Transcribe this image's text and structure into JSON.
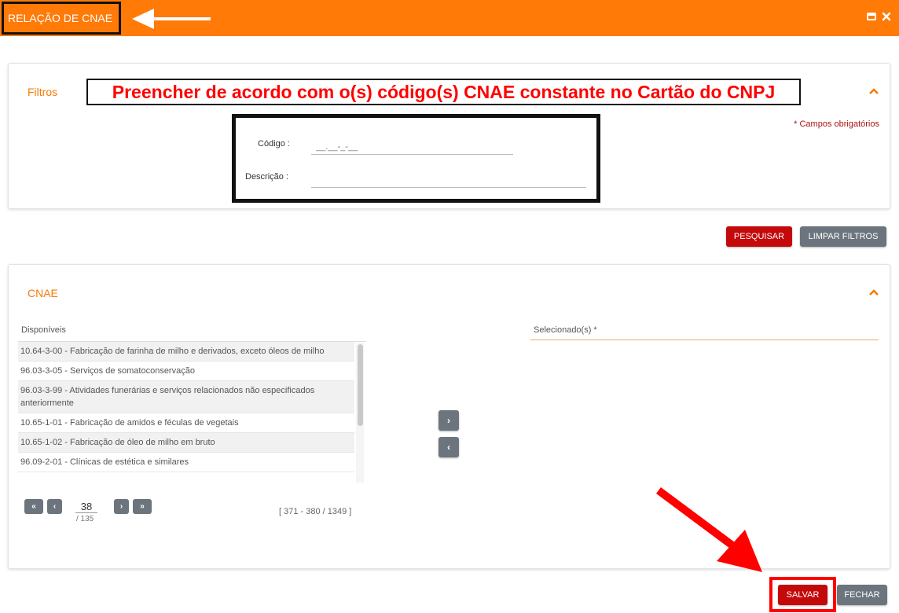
{
  "window": {
    "title": "RELAÇÃO DE CNAE",
    "icons": [
      "window-icon",
      "close-icon"
    ]
  },
  "annotation": {
    "banner": "Preencher de acordo com o(s) código(s) CNAE constante no Cartão do CNPJ"
  },
  "filters": {
    "title": "Filtros",
    "required_note": "* Campos obrigatórios",
    "codigo_label": "Código :",
    "codigo_placeholder": "__.__-_-__",
    "descricao_label": "Descrição :",
    "descricao_value": ""
  },
  "filter_buttons": {
    "search": "PESQUISAR",
    "clear": "LIMPAR FILTROS"
  },
  "cnae": {
    "title": "CNAE",
    "available_header": "Disponíveis",
    "selected_header": "Selecionado(s) *",
    "available_items": [
      "10.64-3-00 - Fabricação de farinha de milho e derivados, exceto óleos de milho",
      "96.03-3-05 - Serviços de somatoconservação",
      "96.03-3-99 - Atividades funerárias e serviços relacionados não especificados anteriormente",
      "10.65-1-01 - Fabricação de amidos e féculas de vegetais",
      "10.65-1-02 - Fabricação de óleo de milho em bruto",
      "96.09-2-01 - Clínicas de estética e similares"
    ],
    "move_right": "›",
    "move_left": "‹"
  },
  "pagination": {
    "first": "«",
    "prev": "‹",
    "next": "›",
    "last": "»",
    "current_page": "38",
    "total_pages": "/ 135",
    "range": "[ 371 - 380 / 1349 ]"
  },
  "footer_buttons": {
    "save": "SALVAR",
    "close": "FECHAR"
  },
  "colors": {
    "brand": "#ff7a07",
    "accent_red": "#c4090b",
    "secondary": "#6c757d"
  }
}
